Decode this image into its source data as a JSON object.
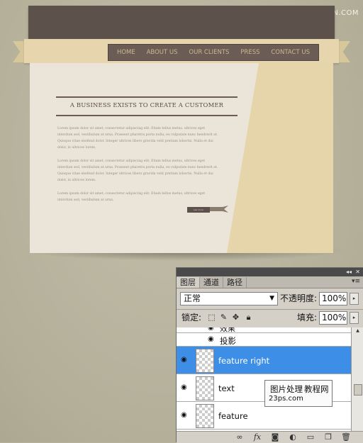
{
  "watermark": "思缘设计论坛 www.MISSYUAN.COM",
  "site": {
    "nav": [
      "HOME",
      "ABOUT US",
      "OUR CLIENTS",
      "PRESS",
      "CONTACT US"
    ],
    "heading": "A BUSINESS EXISTS TO CREATE A CUSTOMER",
    "paragraphs": [
      "Lorem ipsum dolor sit amet, consectetur adipiscing elit. Etiam tellus metus, ultrices eget interdum sed, vestibulum at urna. Praesent pharetra porta nulla, eu vulputate nunc hendrerit at. Quisque vitae eleifend dolor. Integer ultrices libero gravida velit pretium lobortis. Nulla et dui dolor, in ultrices lorem.",
      "Lorem ipsum dolor sit amet, consectetur adipiscing elit. Etiam tellus metus, ultrices eget interdum sed, vestibulum at urna. Praesent pharetra porta nulla, eu vulputate nunc hendrerit at. Quisque vitae eleifend dolor. Integer ultrices libero gravida velit pretium lobortis. Nulla et dui dolor, in ultrices lorem.",
      "Lorem ipsum dolor sit amet, consectetur adipiscing elit. Etiam tellus metus, ultrices eget interdum sed, vestibulum at urna."
    ],
    "more_button": "see more",
    "colors": {
      "header": "#5d514c",
      "ribbon": "#e7d6ad",
      "panel": "#ebe4d8",
      "nav_text": "#c9b98f"
    }
  },
  "layers_panel": {
    "tabs": [
      "图层",
      "通道",
      "路径"
    ],
    "blend_mode": "正常",
    "opacity_label": "不透明度:",
    "opacity_value": "100%",
    "lock_label": "锁定:",
    "fill_label": "填充:",
    "fill_value": "100%",
    "effects_label": "效果",
    "effect_item": "投影",
    "layers": [
      {
        "name": "feature right",
        "selected": true
      },
      {
        "name": "text",
        "selected": false
      },
      {
        "name": "feature",
        "selected": false
      }
    ],
    "selection_color": "#3d8ee6"
  },
  "corner_watermark": {
    "line1": "图片处理",
    "line1b": "教程网",
    "line2": "23ps.com"
  }
}
